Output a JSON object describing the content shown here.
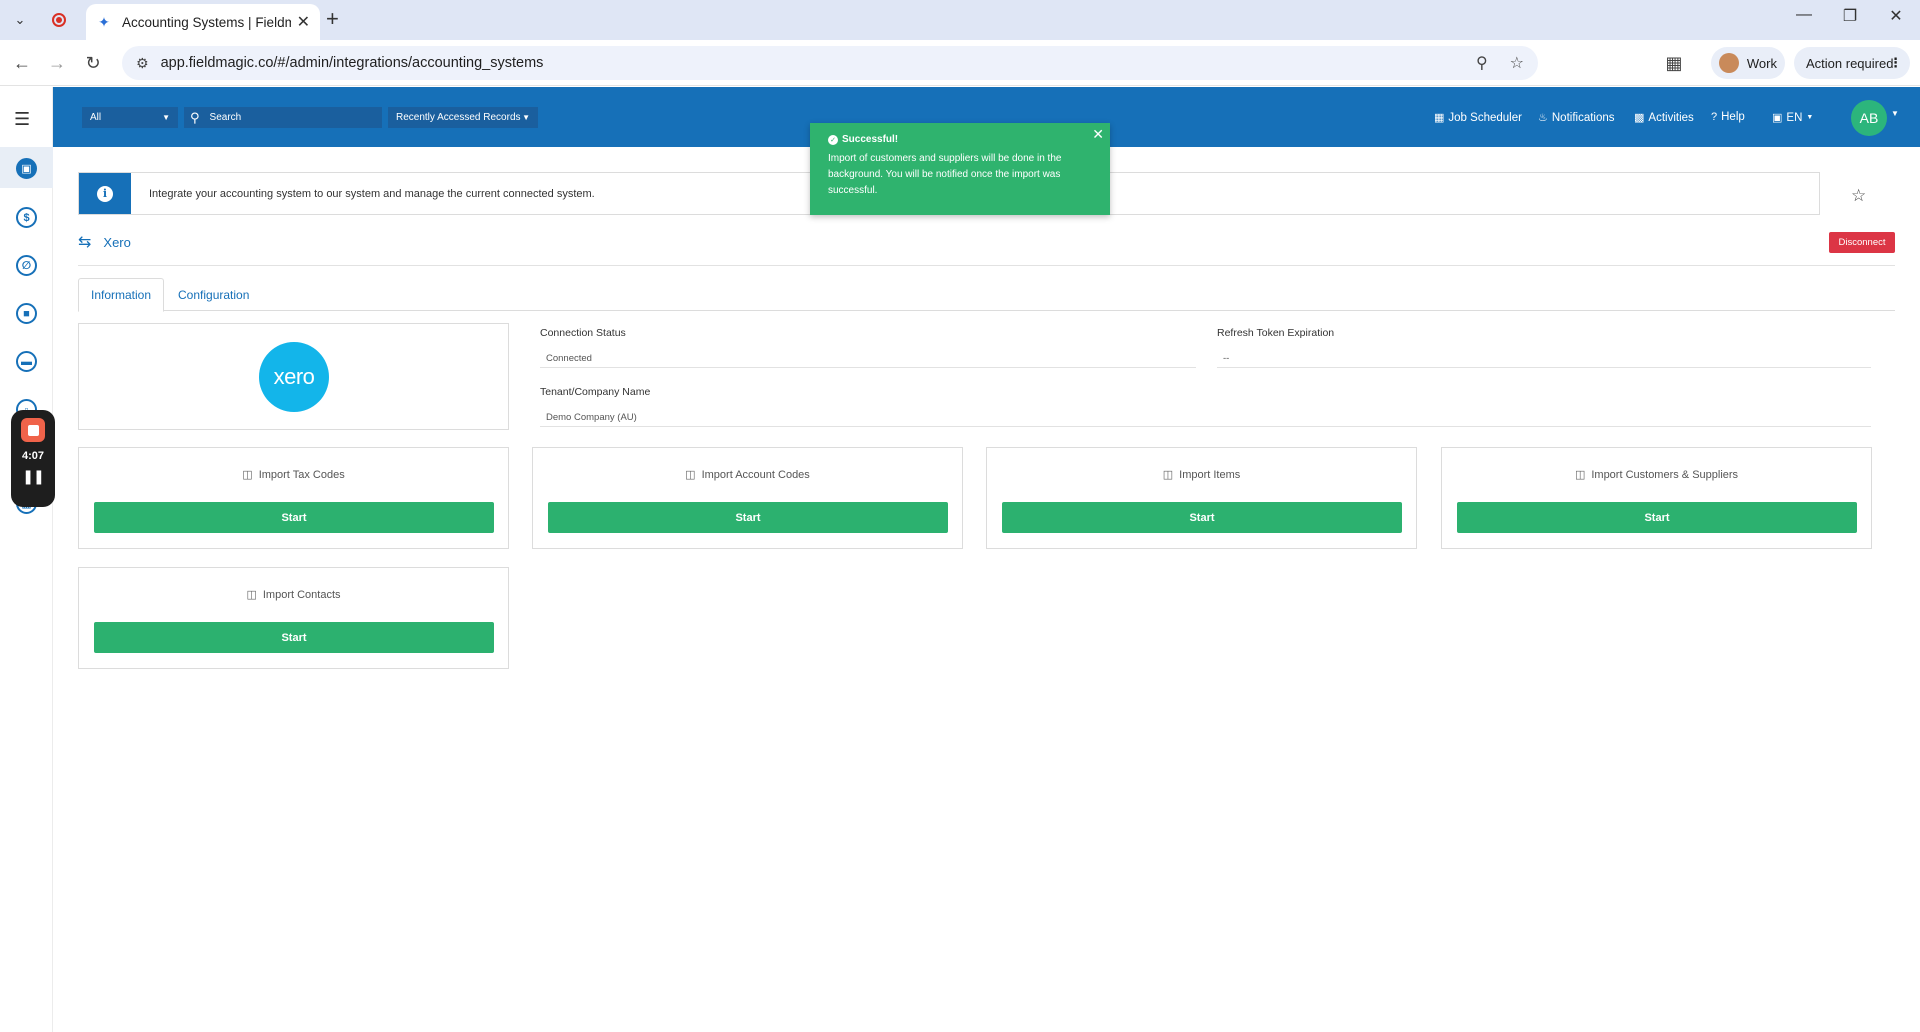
{
  "browser": {
    "tab_title": "Accounting Systems | Fieldmag",
    "url": "app.fieldmagic.co/#/admin/integrations/accounting_systems",
    "profile_label": "Work",
    "action_label": "Action required",
    "extension_badge": "1"
  },
  "header": {
    "filter_select": "All",
    "search_placeholder": "Search",
    "recent_select": "Recently Accessed Records",
    "links": {
      "job_scheduler": "Job Scheduler",
      "notifications": "Notifications",
      "activities": "Activities",
      "help": "Help",
      "language": "EN"
    },
    "avatar_initials": "AB"
  },
  "recorder": {
    "time": "4:07"
  },
  "banner": {
    "text": "Integrate your accounting system to our system and manage the current connected system."
  },
  "integration": {
    "name": "Xero",
    "disconnect_label": "Disconnect",
    "logo_text": "xero"
  },
  "tabs": [
    "Information",
    "Configuration"
  ],
  "fields": {
    "connection_status_label": "Connection Status",
    "connection_status_value": "Connected",
    "refresh_token_label": "Refresh Token Expiration",
    "refresh_token_value": "--",
    "tenant_label": "Tenant/Company Name",
    "tenant_value": "Demo Company (AU)"
  },
  "import_cards": [
    {
      "title": "Import Tax Codes",
      "button": "Start"
    },
    {
      "title": "Import Account Codes",
      "button": "Start"
    },
    {
      "title": "Import Items",
      "button": "Start"
    },
    {
      "title": "Import Customers & Suppliers",
      "button": "Start"
    },
    {
      "title": "Import Contacts",
      "button": "Start"
    }
  ],
  "toast": {
    "title": "Successful!",
    "message": "Import of customers and suppliers will be done in the background. You will be notified once the import was successful."
  },
  "colors": {
    "brand_blue": "#1670b8",
    "success_green": "#2cb16f",
    "danger_red": "#dc3545",
    "xero_blue": "#13b5ea"
  }
}
